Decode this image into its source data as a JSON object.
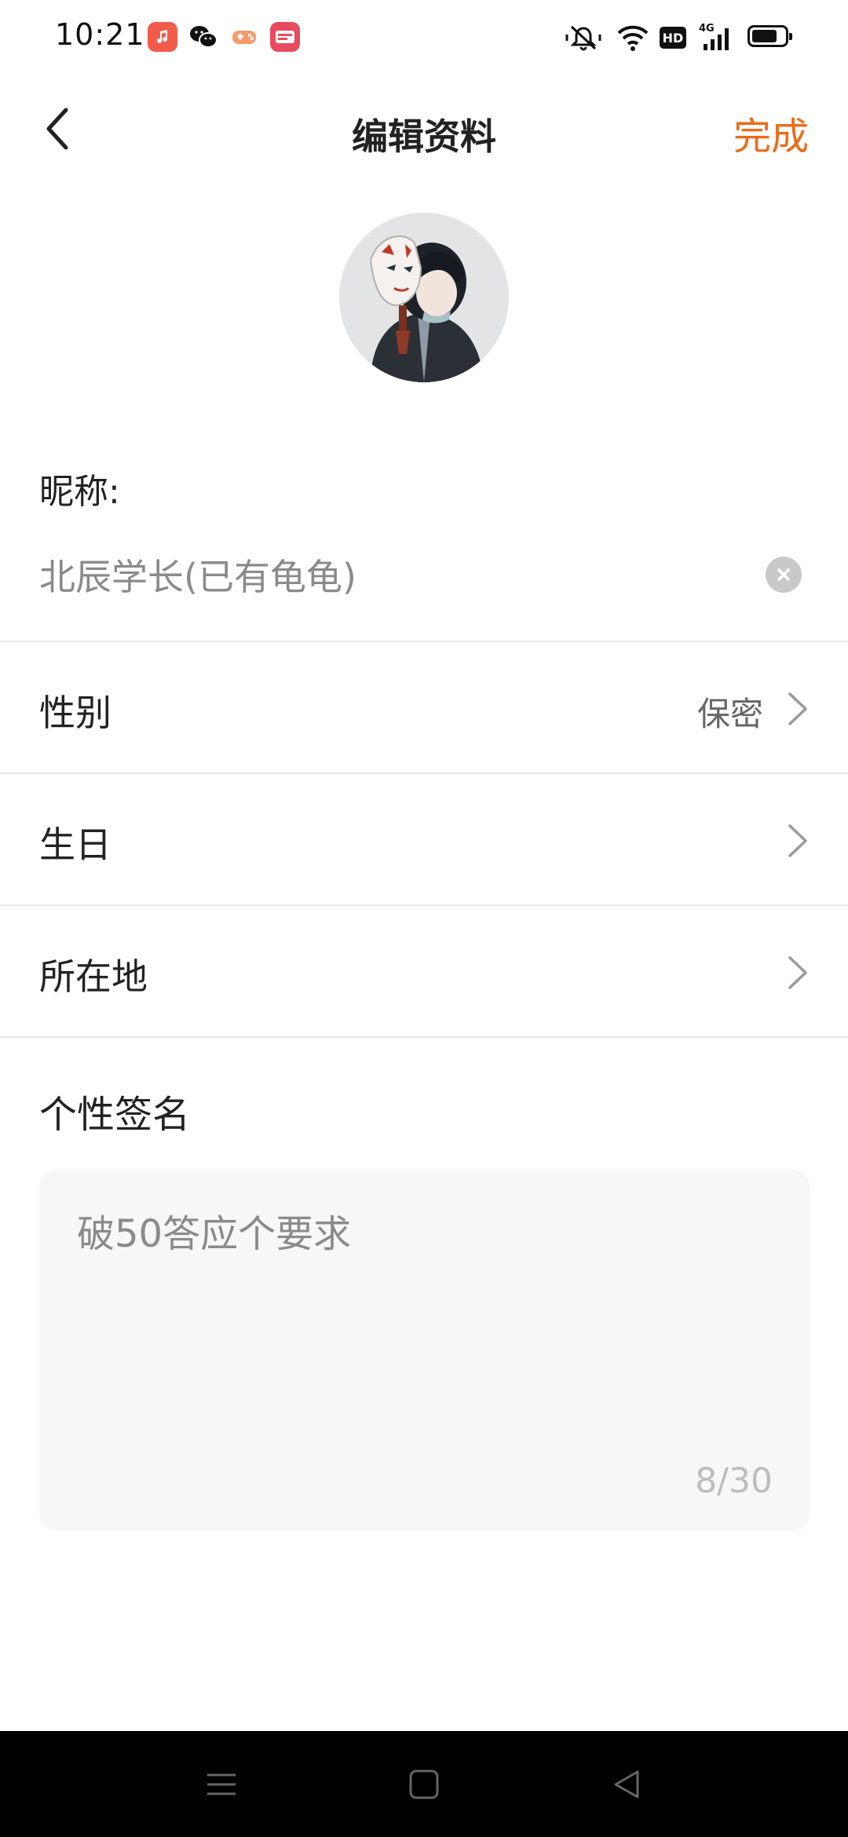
{
  "status_bar": {
    "time": "10:21",
    "network": "4G",
    "hd": "HD",
    "battery_level": 0.8,
    "app_icons": [
      "music-app-icon",
      "wechat-icon",
      "game-app-icon",
      "shopping-app-icon"
    ]
  },
  "header": {
    "title": "编辑资料",
    "done_label": "完成"
  },
  "nickname": {
    "label": "昵称:",
    "value": "北辰学长(已有龟龟)"
  },
  "rows": [
    {
      "label": "性别",
      "value": "保密"
    },
    {
      "label": "生日",
      "value": ""
    },
    {
      "label": "所在地",
      "value": ""
    }
  ],
  "signature": {
    "label": "个性签名",
    "value": "破50答应个要求",
    "counter": "8/30"
  },
  "colors": {
    "accent": "#ec6b1a",
    "divider": "#e9e9e9",
    "input_bg": "#f7f7f7"
  }
}
